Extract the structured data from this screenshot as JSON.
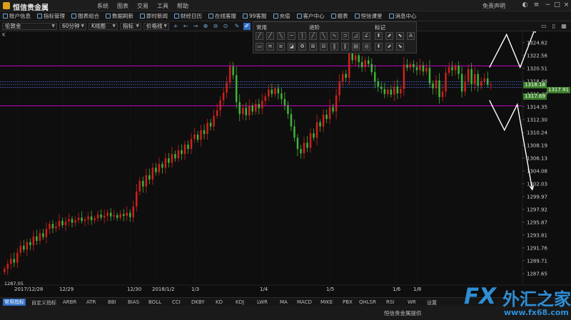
{
  "app": {
    "title": "恒信贵金属",
    "menu": [
      "系统",
      "图表",
      "交易",
      "工具",
      "帮助"
    ],
    "disclaimer": "免责声明"
  },
  "toolbar": {
    "items": [
      "账户信息",
      "指标管理",
      "图表组合",
      "数据刷新",
      "即时新闻",
      "财经日历",
      "在线客服",
      "99客服",
      "充值",
      "客户中心",
      "报表",
      "恒信课堂",
      "消息中心"
    ]
  },
  "chartbar": {
    "symbol": "伦敦金",
    "period": "60分钟",
    "chart_type": "K线图",
    "indicator": "指标",
    "price_line": "价格线"
  },
  "draw_panel": {
    "sections": [
      "常用",
      "进阶",
      "标记"
    ]
  },
  "chart_label": "K",
  "price_axis": [
    "1324.62",
    "1322.56",
    "1320.51",
    "1318.46",
    "1316.40",
    "1314.35",
    "1312.30",
    "1310.24",
    "1308.19",
    "1306.13",
    "1304.08",
    "1302.03",
    "1299.97",
    "1297.92",
    "1295.87",
    "1293.81",
    "1291.76",
    "1289.71",
    "1287.65"
  ],
  "date_axis": [
    "2017/12/28",
    "12/29",
    "12/30",
    "2018/1/2",
    "1/3",
    "1/4",
    "1/5",
    "1/6",
    "1/8"
  ],
  "price_tags": {
    "upper": "1318.18",
    "current": "1317.91",
    "lower": "1317.69"
  },
  "low_label": "1287.05",
  "bottom_tabs": [
    "常用指标",
    "自定义指标",
    "ARBR",
    "ATR",
    "BBI",
    "BIAS",
    "BOLL",
    "CCI",
    "DKBY",
    "KD",
    "KDJ",
    "LWR",
    "MA",
    "MACD",
    "MIKE",
    "PBX",
    "QHLSR",
    "RSI",
    "WR",
    "设置"
  ],
  "status": {
    "provider": "恒信贵金属提供"
  },
  "watermark": {
    "fx": "FX",
    "cn": "外汇之家",
    "url": "www.fx68.com"
  },
  "colors": {
    "up": "#d0211c",
    "down": "#3fb536",
    "magenta": "#e000e0",
    "accent": "#2d6cc4"
  },
  "chart_data": {
    "type": "candlestick",
    "ylim": [
      1286.5,
      1326.2
    ],
    "resistance": 1320.9,
    "support": 1314.5,
    "current": 1317.91,
    "start_open": 1287.9,
    "low": 1287.05,
    "closes": [
      1288.4,
      1289.2,
      1290.0,
      1289.4,
      1291.0,
      1292.1,
      1291.5,
      1292.7,
      1292.2,
      1293.6,
      1292.9,
      1294.1,
      1293.5,
      1294.8,
      1295.6,
      1294.9,
      1295.2,
      1296.1,
      1295.4,
      1296.0,
      1296.4,
      1295.8,
      1296.2,
      1296.6,
      1296.1,
      1296.3,
      1296.8,
      1296.2,
      1296.5,
      1297.1,
      1296.6,
      1296.9,
      1297.4,
      1296.8,
      1297.0,
      1296.6,
      1297.2,
      1296.9,
      1297.4,
      1296.7,
      1298.4,
      1300.8,
      1302.5,
      1301.6,
      1303.4,
      1302.7,
      1304.6,
      1303.9,
      1305.2,
      1304.6,
      1306.1,
      1305.4,
      1306.8,
      1306.1,
      1307.4,
      1306.8,
      1308.3,
      1307.6,
      1309.2,
      1309.9,
      1309.1,
      1310.6,
      1310.0,
      1311.8,
      1311.2,
      1312.9,
      1313.8,
      1315.4,
      1316.6,
      1318.2,
      1320.8,
      1319.4,
      1315.1,
      1313.2,
      1314.2,
      1313.0,
      1314.5,
      1313.6,
      1314.8,
      1314.1,
      1315.3,
      1316.0,
      1317.1,
      1316.4,
      1317.3,
      1316.5,
      1315.6,
      1314.6,
      1313.2,
      1311.2,
      1309.4,
      1307.6,
      1306.9,
      1308.6,
      1307.8,
      1310.1,
      1309.4,
      1311.9,
      1311.2,
      1313.1,
      1312.4,
      1314.3,
      1313.6,
      1316.2,
      1318.4,
      1319.6,
      1319.0,
      1323.4,
      1321.8,
      1322.6,
      1321.5,
      1320.7,
      1321.8,
      1321.2,
      1319.9,
      1318.4,
      1317.6,
      1317.2,
      1316.4,
      1317.1,
      1316.3,
      1317.6,
      1316.5,
      1317.2,
      1321.1,
      1320.6,
      1321.2,
      1320.7,
      1320.2,
      1321.0,
      1320.0,
      1320.6,
      1318.1,
      1317.3,
      1318.6,
      1315.9,
      1316.8,
      1319.8,
      1320.7,
      1320.2,
      1320.9,
      1319.6,
      1316.8,
      1318.4,
      1320.4,
      1318.0,
      1319.6,
      1317.7,
      1318.4,
      1318.9,
      1317.9,
      1317.91
    ]
  }
}
